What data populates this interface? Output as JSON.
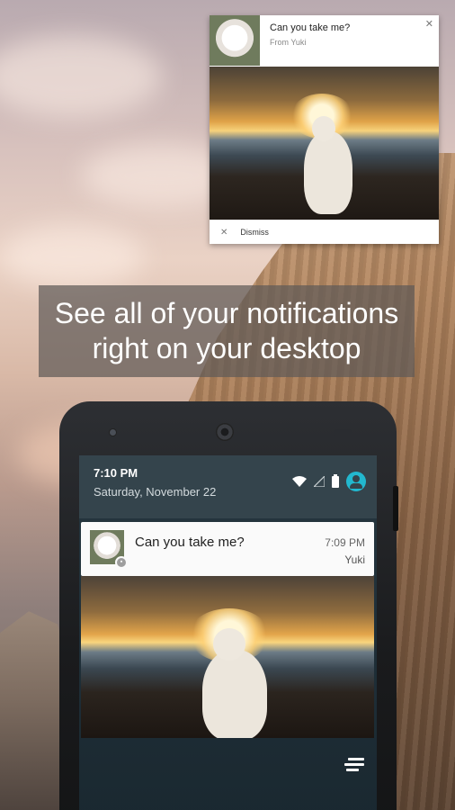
{
  "desktop_notification": {
    "title": "Can you take me?",
    "from": "From Yuki",
    "close_icon": "close-icon",
    "dismiss_label": "Dismiss"
  },
  "banner": {
    "line1": "See all of your notifications",
    "line2": "right on your desktop"
  },
  "phone": {
    "status": {
      "time": "7:10 PM",
      "date": "Saturday, November 22",
      "icons": [
        "wifi-icon",
        "cellular-icon",
        "battery-icon",
        "user-account-icon"
      ],
      "accent": "#22b8cf"
    },
    "notification": {
      "title": "Can you take me?",
      "time": "7:09 PM",
      "sender": "Yuki",
      "badge_icon": "app-badge-icon"
    },
    "menu_icon": "menu-icon"
  }
}
